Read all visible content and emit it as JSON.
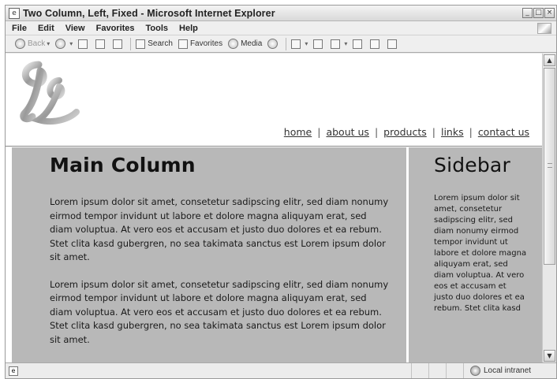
{
  "window": {
    "title": "Two Column, Left, Fixed - Microsoft Internet Explorer",
    "controls": [
      "minimize",
      "maximize",
      "close"
    ]
  },
  "menu": {
    "items": [
      "File",
      "Edit",
      "View",
      "Favorites",
      "Tools",
      "Help"
    ]
  },
  "toolbar": {
    "back": "Back",
    "search": "Search",
    "favorites": "Favorites",
    "media": "Media"
  },
  "site": {
    "nav": [
      "home",
      "about us",
      "products",
      "links",
      "contact us"
    ],
    "main_title": "Main Column",
    "main_paragraphs": [
      "Lorem ipsum dolor sit amet, consetetur sadipscing elitr, sed diam nonumy eirmod tempor invidunt ut labore et dolore magna aliquyam erat, sed diam voluptua. At vero eos et accusam et justo duo dolores et ea rebum. Stet clita kasd gubergren, no sea takimata sanctus est Lorem ipsum dolor sit amet.",
      "Lorem ipsum dolor sit amet, consetetur sadipscing elitr, sed diam nonumy eirmod tempor invidunt ut labore et dolore magna aliquyam erat, sed diam voluptua. At vero eos et accusam et justo duo dolores et ea rebum. Stet clita kasd gubergren, no sea takimata sanctus est Lorem ipsum dolor sit amet."
    ],
    "sidebar_title": "Sidebar",
    "sidebar_text": "Lorem ipsum dolor sit amet, consetetur sadipscing elitr, sed diam nonumy eirmod tempor invidunt ut labore et dolore magna aliquyam erat, sed diam voluptua. At vero eos et accusam et justo duo dolores et ea rebum. Stet clita kasd"
  },
  "status": {
    "zone": "Local intranet"
  },
  "colors": {
    "column_bg": "#b8b8b8",
    "header_bg": "#ffffff"
  }
}
